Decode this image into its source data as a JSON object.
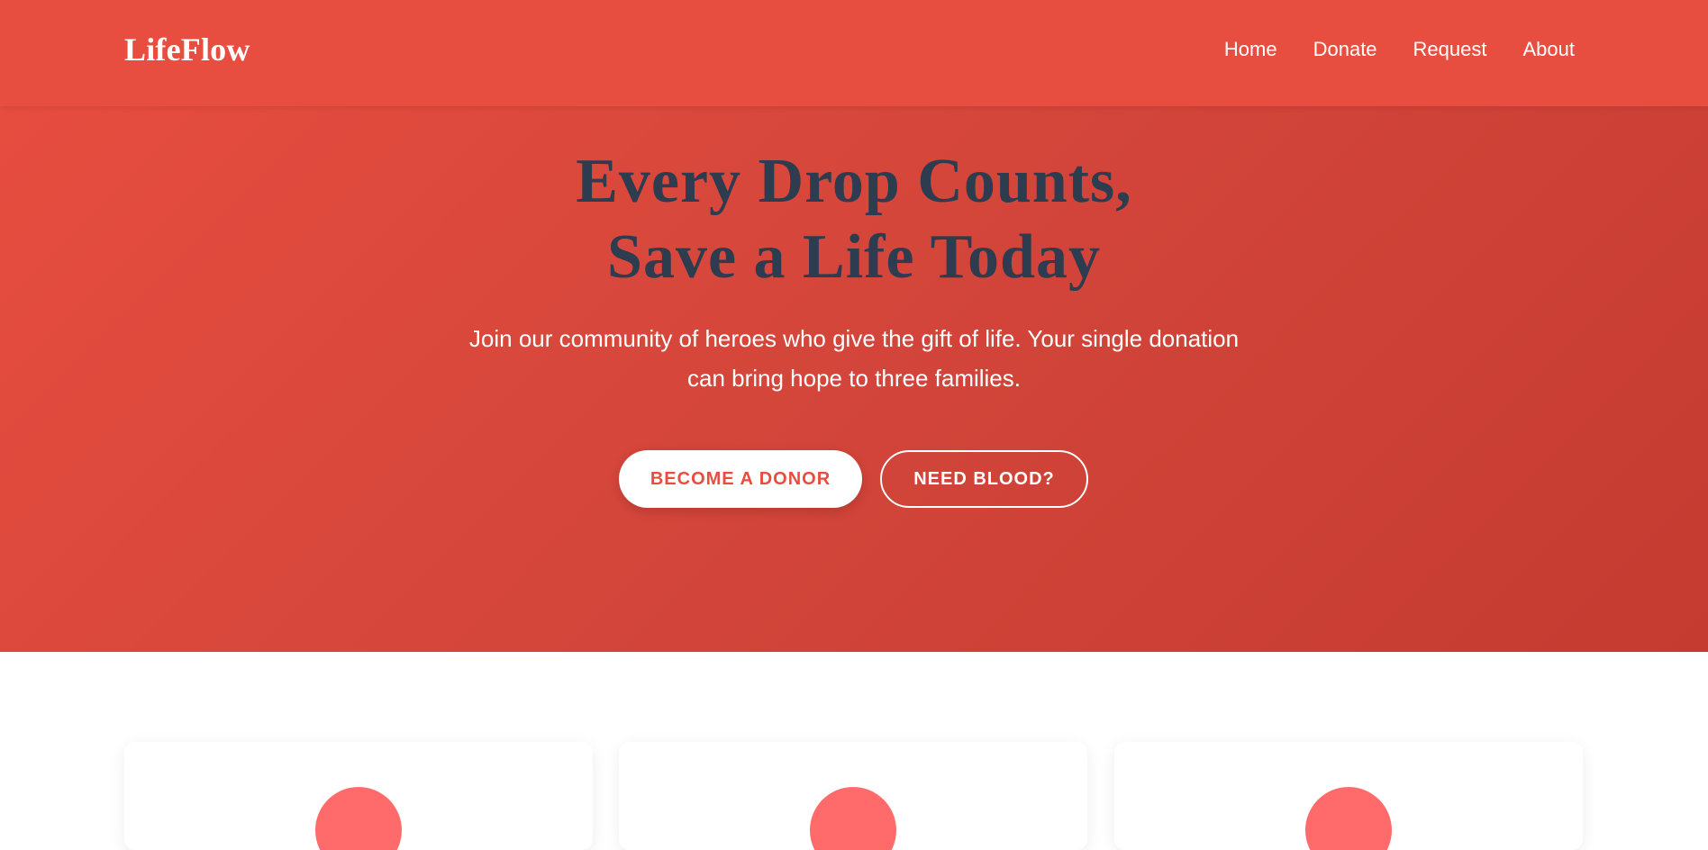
{
  "brand": {
    "name": "LifeFlow",
    "accent": "#e84e40",
    "title_color": "#2e3c4f",
    "icon_color": "#ff6b6b"
  },
  "nav": {
    "items": [
      "Home",
      "Donate",
      "Request",
      "About"
    ]
  },
  "hero": {
    "title_lines": [
      "Every Drop Counts,",
      "Save a Life Today"
    ],
    "subtitle_lines": [
      "Join our community of heroes who give the gift of life. Your single donation",
      "can bring hope to three families."
    ],
    "primary_button": "BECOME A DONOR",
    "secondary_button": "NEED BLOOD?"
  },
  "cards": [
    {
      "icon": "circle-icon"
    },
    {
      "icon": "circle-icon"
    },
    {
      "icon": "circle-icon"
    }
  ]
}
